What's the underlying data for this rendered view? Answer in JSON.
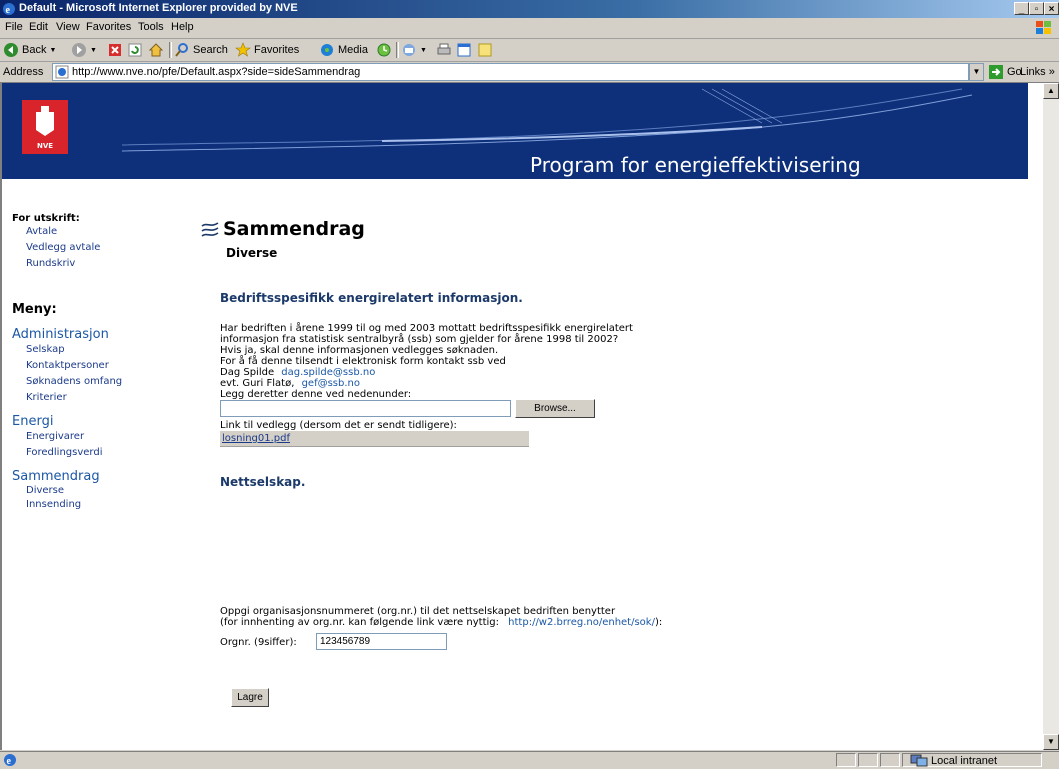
{
  "window": {
    "title": "Default - Microsoft Internet Explorer provided by NVE"
  },
  "menu": [
    "File",
    "Edit",
    "View",
    "Favorites",
    "Tools",
    "Help"
  ],
  "toolbar": {
    "back": "Back",
    "search": "Search",
    "favorites": "Favorites",
    "media": "Media"
  },
  "address": {
    "label": "Address",
    "url": "http://www.nve.no/pfe/Default.aspx?side=sideSammendrag",
    "go": "Go",
    "links": "Links"
  },
  "banner": {
    "logo_text": "NVE",
    "program": "Program for energieffektivisering"
  },
  "leftnav": {
    "print_heading": "For utskrift:",
    "print_links": [
      "Avtale",
      "Vedlegg avtale",
      "Rundskriv"
    ],
    "menu_heading": "Meny:",
    "sections": [
      {
        "label": "Administrasjon",
        "items": [
          "Selskap",
          "Kontaktpersoner",
          "Søknadens omfang",
          "Kriterier"
        ]
      },
      {
        "label": "Energi",
        "items": [
          "Energivarer",
          "Foredlingsverdi"
        ]
      },
      {
        "label": "Sammendrag",
        "items": [
          "Diverse",
          "Innsending"
        ]
      }
    ]
  },
  "main": {
    "title": "Sammendrag",
    "subtitle": "Diverse",
    "section1": {
      "heading": "Bedriftsspesifikk energirelatert informasjon.",
      "line1": "Har bedriften i årene 1999 til og med 2003 mottatt bedriftsspesifikk energirelatert",
      "line2": "informasjon fra statistisk sentralbyrå (ssb) som gjelder for årene 1998 til 2002?",
      "line3": "Hvis ja, skal denne informasjonen vedlegges søknaden.",
      "line4": "For å få denne tilsendt i elektronisk form kontakt ssb ved",
      "contact1_name": "Dag Spilde",
      "contact1_email": "dag.spilde@ssb.no",
      "contact2_name": "evt. Guri Flatø,",
      "contact2_email": "gef@ssb.no",
      "upload_label": "Legg deretter denne ved nedenunder:",
      "browse_button": "Browse...",
      "link_label": "Link til vedlegg (dersom det er sendt tidligere):",
      "existing_file": "losning01.pdf"
    },
    "section2": {
      "heading": "Nettselskap.",
      "line1": "Oppgi organisasjonsnummeret (org.nr.) til det nettselskapet bedriften benytter",
      "line2_prefix": "(for innhenting av org.nr. kan følgende link være nyttig:",
      "line2_link": "http://w2.brreg.no/enhet/sok/",
      "line2_suffix": "):",
      "orgnr_label": "Orgnr. (9siffer):",
      "orgnr_value": "123456789"
    },
    "save_button": "Lagre"
  },
  "status": {
    "zone": "Local intranet"
  }
}
